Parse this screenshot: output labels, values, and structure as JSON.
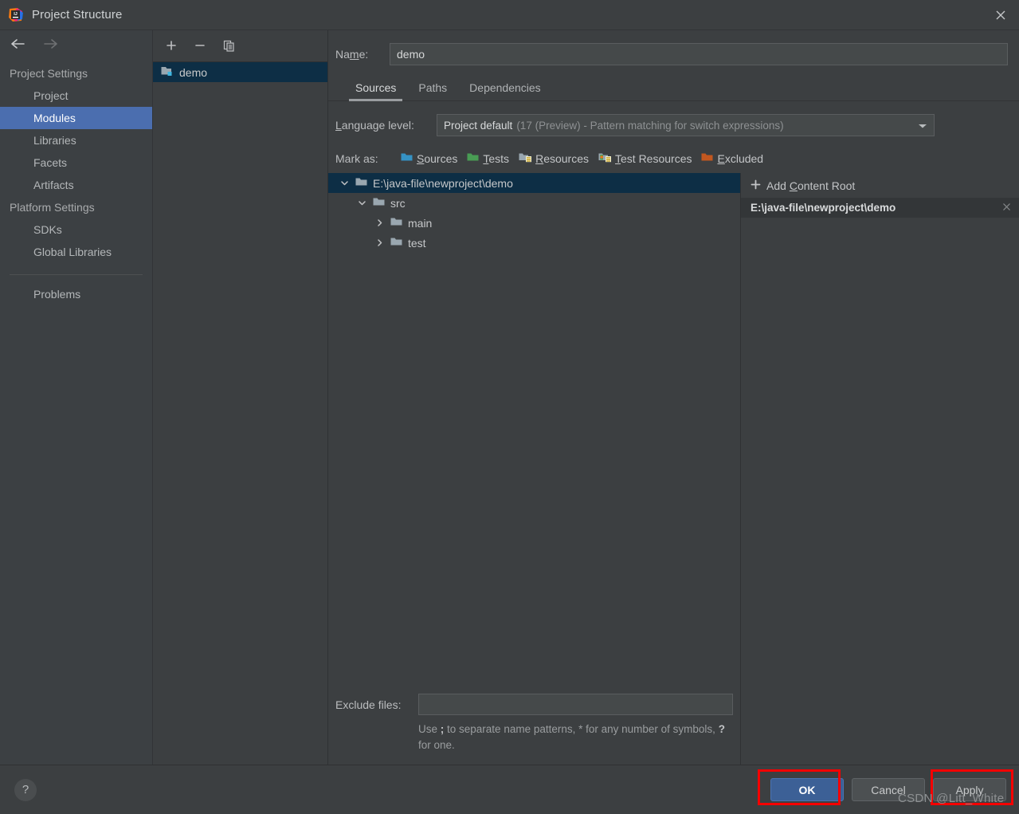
{
  "window": {
    "title": "Project Structure",
    "app_icon": "intellij-idea-icon",
    "close_icon": "close-icon"
  },
  "nav": {
    "back_icon": "arrow-left-icon",
    "forward_icon": "arrow-right-icon",
    "groups": [
      {
        "label": "Project Settings",
        "items": [
          {
            "label": "Project",
            "selected": false
          },
          {
            "label": "Modules",
            "selected": true
          },
          {
            "label": "Libraries",
            "selected": false
          },
          {
            "label": "Facets",
            "selected": false
          },
          {
            "label": "Artifacts",
            "selected": false
          }
        ]
      },
      {
        "label": "Platform Settings",
        "items": [
          {
            "label": "SDKs",
            "selected": false
          },
          {
            "label": "Global Libraries",
            "selected": false
          }
        ]
      }
    ],
    "extra": [
      {
        "label": "Problems",
        "selected": false
      }
    ]
  },
  "modules_panel": {
    "toolbar": [
      {
        "icon": "plus-icon",
        "tooltip": "Add"
      },
      {
        "icon": "minus-icon",
        "tooltip": "Remove"
      },
      {
        "icon": "copy-icon",
        "tooltip": "Copy"
      }
    ],
    "items": [
      {
        "label": "demo",
        "icon": "module-folder-icon",
        "selected": true
      }
    ]
  },
  "main": {
    "name_label": "Name:",
    "name_label_mnemonic": "m",
    "name_value": "demo",
    "tabs": [
      {
        "label": "Sources",
        "active": true
      },
      {
        "label": "Paths",
        "active": false
      },
      {
        "label": "Dependencies",
        "active": false
      }
    ],
    "language_level": {
      "label": "Language level:",
      "label_mnemonic": "L",
      "value_main": "Project default",
      "value_detail": "(17 (Preview) - Pattern matching for switch expressions)",
      "arrow_icon": "chevron-down-icon"
    },
    "mark_as": {
      "label": "Mark as:",
      "options": [
        {
          "label": "Sources",
          "mnemonic": "S",
          "icon": "folder-sources-icon",
          "color": "#3592c4"
        },
        {
          "label": "Tests",
          "mnemonic": "T",
          "icon": "folder-tests-icon",
          "color": "#499c54"
        },
        {
          "label": "Resources",
          "mnemonic": "R",
          "icon": "folder-resources-icon",
          "color": "#9aa7b0"
        },
        {
          "label": "Test Resources",
          "mnemonic": "T",
          "icon": "folder-test-resources-icon",
          "color": "#9aa7b0"
        },
        {
          "label": "Excluded",
          "mnemonic": "E",
          "icon": "folder-excluded-icon",
          "color": "#c75450"
        }
      ]
    },
    "tree": [
      {
        "label": "E:\\java-file\\newproject\\demo",
        "depth": 0,
        "expanded": true,
        "has_children": true,
        "selected": true
      },
      {
        "label": "src",
        "depth": 1,
        "expanded": true,
        "has_children": true,
        "selected": false
      },
      {
        "label": "main",
        "depth": 2,
        "expanded": false,
        "has_children": true,
        "selected": false
      },
      {
        "label": "test",
        "depth": 2,
        "expanded": false,
        "has_children": true,
        "selected": false
      }
    ],
    "exclude": {
      "label": "Exclude files:",
      "value": "",
      "hint_prefix": "Use ",
      "hint_semicolon": ";",
      "hint_mid": " to separate name patterns, * for any number of symbols, ",
      "hint_question": "?",
      "hint_suffix": " for one."
    },
    "content_roots": {
      "add_label": "Add Content Root",
      "add_mnemonic": "C",
      "add_icon": "plus-icon",
      "items": [
        {
          "path": "E:\\java-file\\newproject\\demo",
          "remove_icon": "close-icon"
        }
      ]
    }
  },
  "footer": {
    "help_icon": "help-icon",
    "buttons": [
      {
        "label": "OK",
        "primary": true,
        "annotated": true
      },
      {
        "label": "Cancel",
        "primary": false,
        "annotated": false
      },
      {
        "label": "Apply",
        "primary": false,
        "annotated": true
      }
    ]
  },
  "watermark": {
    "text": "CSDN @Litt_White"
  },
  "colors": {
    "background": "#3c3f41",
    "nav_background": "#3c4043",
    "selection_blue": "#4b6eaf",
    "tree_selection": "#0d2e45",
    "primary_button": "#3c6096",
    "annotation_red": "#f60000"
  }
}
